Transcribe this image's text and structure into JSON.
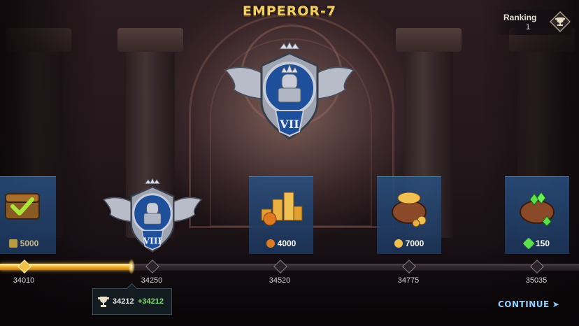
{
  "title": "EMPEROR-7",
  "ranking": {
    "label": "Ranking",
    "value": "1",
    "icon": "trophy-icon"
  },
  "current_tier_badge": {
    "numeral": "VII",
    "icon": "emperor-badge-icon"
  },
  "rewards": [
    {
      "id": "crowns",
      "amount": "5000",
      "icon": "crown-icon",
      "claimed": true
    },
    {
      "id": "tier",
      "numeral": "VIII",
      "icon": "emperor-badge-icon"
    },
    {
      "id": "gold-stacks",
      "amount": "4000",
      "icon": "gold-coin-stack-icon"
    },
    {
      "id": "gold-bag",
      "amount": "7000",
      "icon": "coin-bag-icon"
    },
    {
      "id": "gem-bag",
      "amount": "150",
      "icon": "gem-bag-icon"
    }
  ],
  "milestones": [
    "34010",
    "34250",
    "34520",
    "34775",
    "35035"
  ],
  "current": {
    "trophies": "34212",
    "gain": "+34212",
    "progress_fraction": 0.227
  },
  "continue_label": "CONTINUE",
  "colors": {
    "accent_gold": "#f1cf63",
    "card_blue": "#284e84",
    "gain_green": "#7de06a",
    "continue_blue": "#8fd0ff"
  }
}
